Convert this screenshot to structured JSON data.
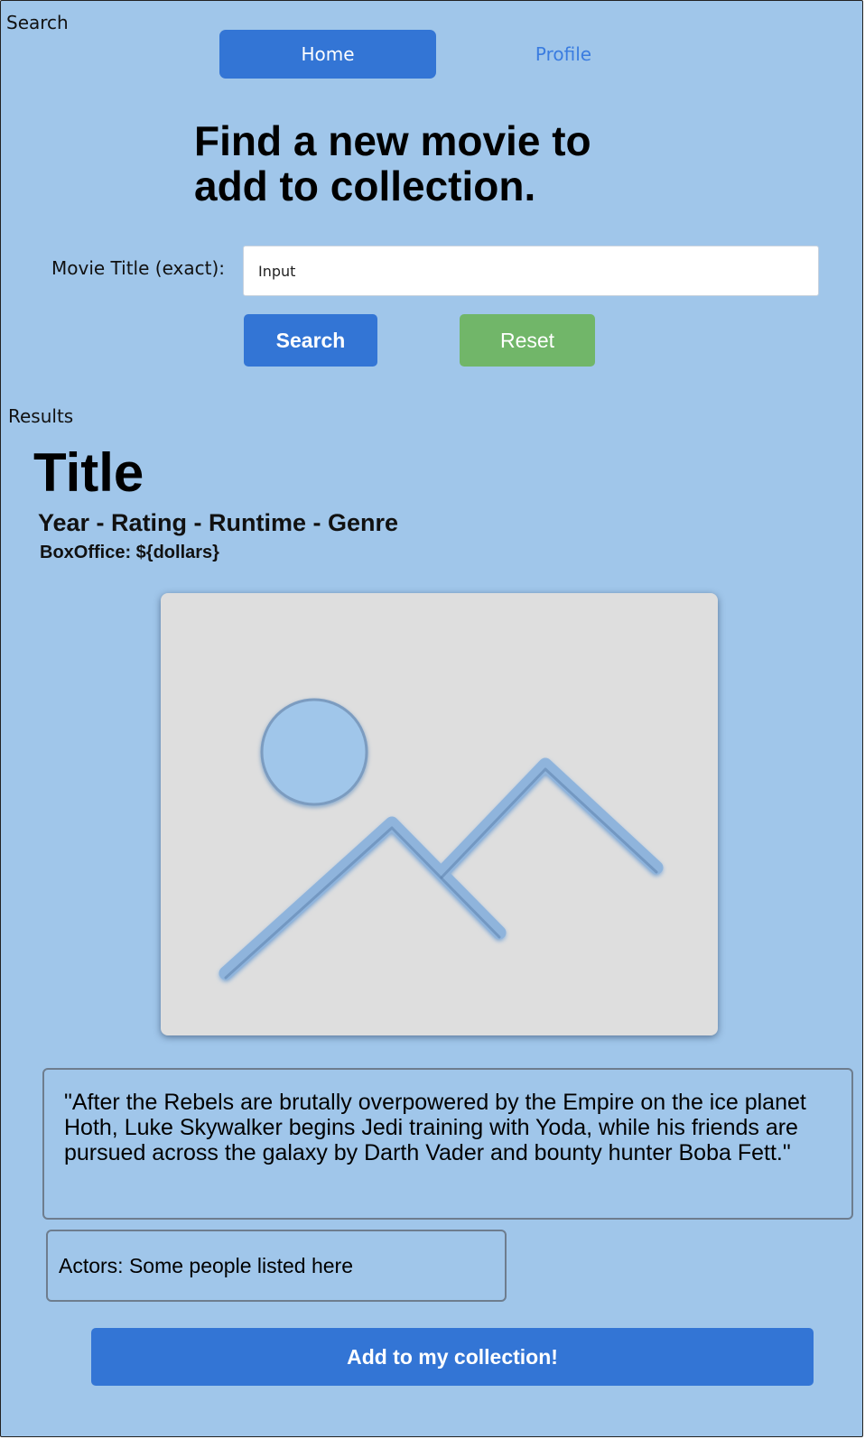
{
  "screen_label": "Search",
  "nav": {
    "home_label": "Home",
    "profile_label": "Profile"
  },
  "headline": {
    "line1": "Find a new movie to",
    "line2": "add to collection."
  },
  "search_form": {
    "field_label": "Movie Title (exact):",
    "input_value": "Input",
    "search_label": "Search",
    "reset_label": "Reset"
  },
  "results": {
    "label": "Results",
    "title": "Title",
    "meta": "Year - Rating - Runtime - Genre",
    "box_office": "BoxOffice: ${dollars}",
    "poster_icon": "image-placeholder-icon",
    "plot": "\"After the Rebels are brutally overpowered by the Empire on the ice planet Hoth, Luke Skywalker begins Jedi training with Yoda, while his friends are pursued across the galaxy by Darth Vader and bounty hunter Boba Fett.\"",
    "actors": "Actors: Some people listed here",
    "add_label": "Add to my collection!"
  },
  "colors": {
    "background": "#a0c6ea",
    "primary": "#3375d5",
    "reset": "#71b669",
    "poster_bg": "#dedede",
    "poster_glyph": "#a0c6ea"
  }
}
